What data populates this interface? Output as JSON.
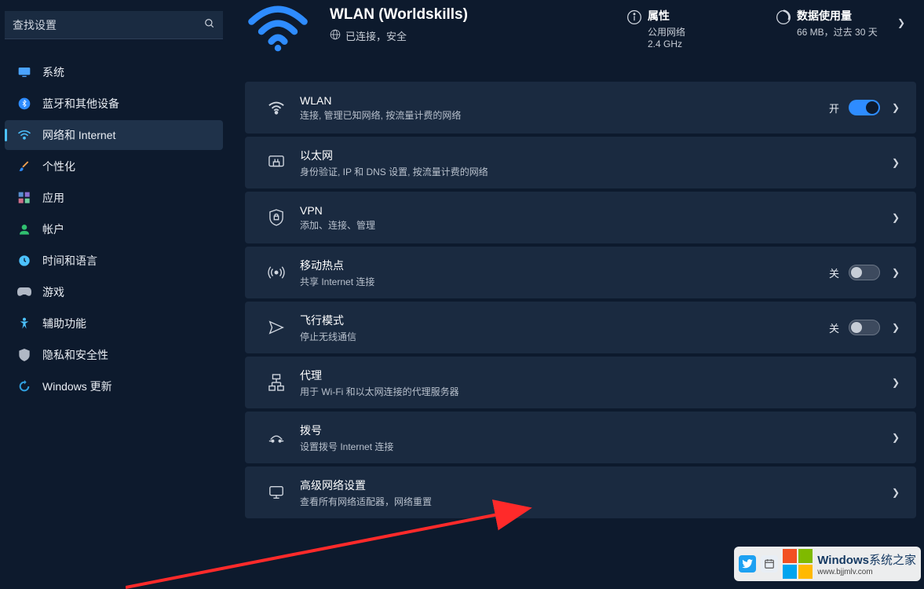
{
  "search": {
    "placeholder": "查找设置"
  },
  "sidebar": {
    "items": [
      {
        "label": "系统"
      },
      {
        "label": "蓝牙和其他设备"
      },
      {
        "label": "网络和 Internet"
      },
      {
        "label": "个性化"
      },
      {
        "label": "应用"
      },
      {
        "label": "帐户"
      },
      {
        "label": "时间和语言"
      },
      {
        "label": "游戏"
      },
      {
        "label": "辅助功能"
      },
      {
        "label": "隐私和安全性"
      },
      {
        "label": "Windows 更新"
      }
    ]
  },
  "header": {
    "title": "WLAN (Worldskills)",
    "status": "已连接，安全"
  },
  "info": {
    "properties": {
      "title": "属性",
      "line1": "公用网络",
      "line2": "2.4 GHz"
    },
    "usage": {
      "title": "数据使用量",
      "line1": "66 MB，过去 30 天"
    }
  },
  "rows": {
    "wlan": {
      "title": "WLAN",
      "sub": "连接, 管理已知网络, 按流量计费的网络",
      "state": "开"
    },
    "ether": {
      "title": "以太网",
      "sub": "身份验证, IP 和 DNS 设置, 按流量计费的网络"
    },
    "vpn": {
      "title": "VPN",
      "sub": "添加、连接、管理"
    },
    "hotspot": {
      "title": "移动热点",
      "sub": "共享 Internet 连接",
      "state": "关"
    },
    "air": {
      "title": "飞行模式",
      "sub": "停止无线通信",
      "state": "关"
    },
    "proxy": {
      "title": "代理",
      "sub": "用于 Wi-Fi 和以太网连接的代理服务器"
    },
    "dial": {
      "title": "拨号",
      "sub": "设置拨号 Internet 连接"
    },
    "adv": {
      "title": "高级网络设置",
      "sub": "查看所有网络适配器，网络重置"
    }
  },
  "watermark": {
    "brand": "Windows",
    "brand_suffix": "系统之家",
    "url": "www.bjjmlv.com"
  }
}
